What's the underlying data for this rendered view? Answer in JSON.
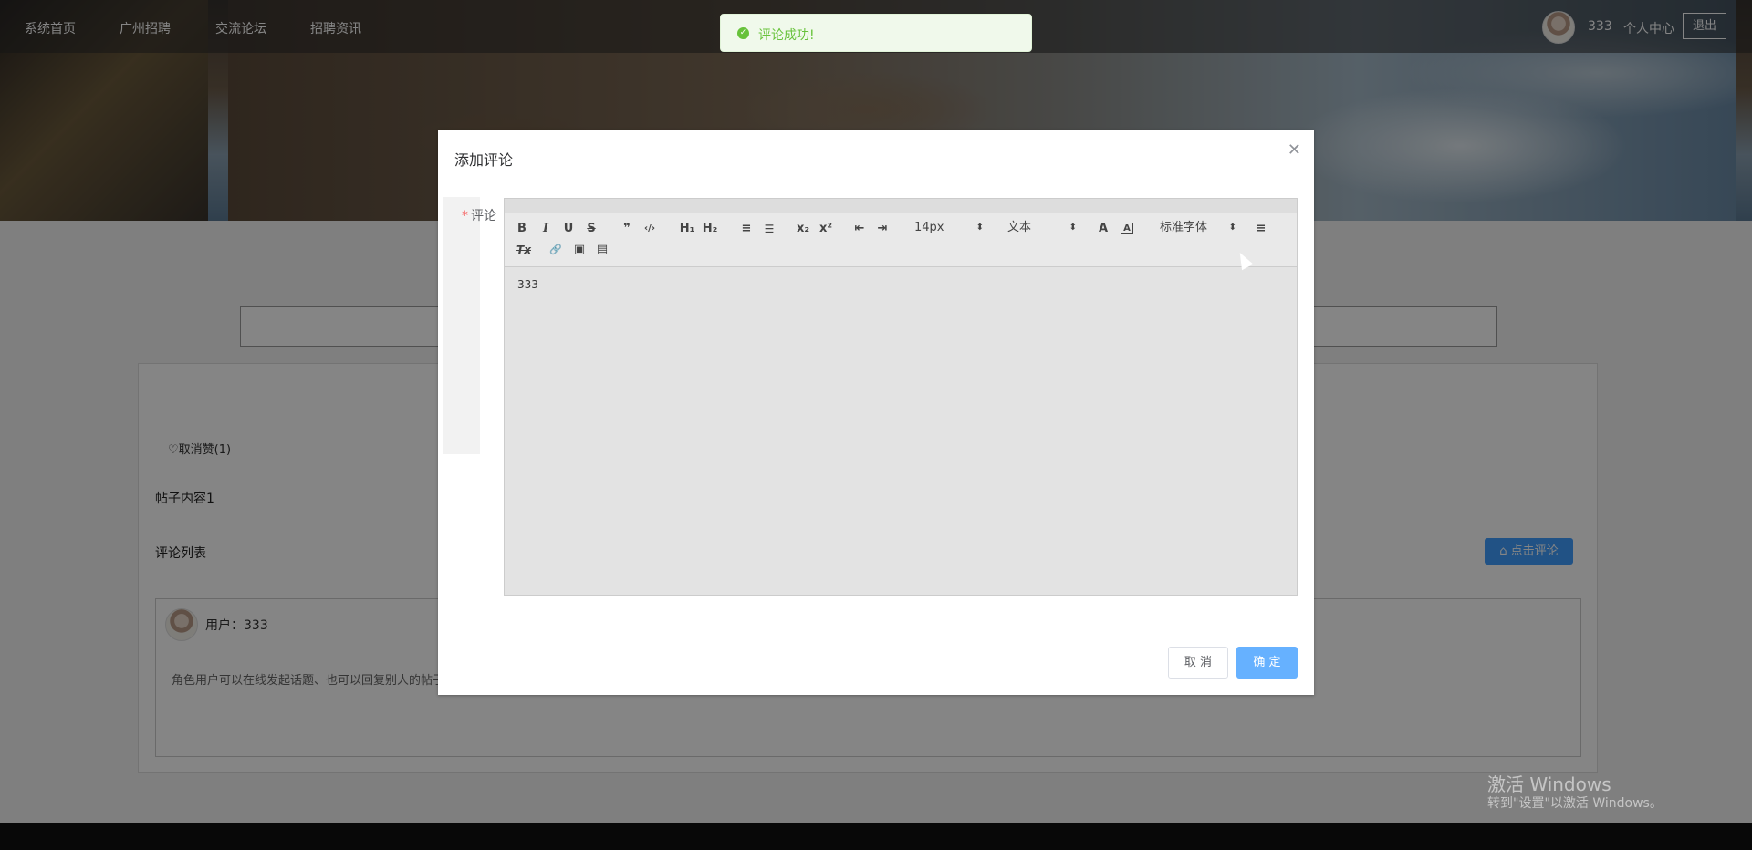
{
  "nav": {
    "items": [
      "系统首页",
      "广州招聘",
      "交流论坛",
      "招聘资讯"
    ],
    "username": "333",
    "personal_center": "个人中心",
    "logout": "退出"
  },
  "post": {
    "like_label": "♡取消赞(1)",
    "content": "帖子内容1",
    "comment_list_title": "评论列表",
    "click_comment_button": "⌂ 点击评论"
  },
  "comment": {
    "user_label": "用户：333",
    "text": "角色用户可以在线发起话题、也可以回复别人的帖子"
  },
  "toast": {
    "message": "评论成功!",
    "icon": "check-circle-icon",
    "color": "#67c23a"
  },
  "dialog": {
    "title": "添加评论",
    "field_label": "评论",
    "required_mark": "*",
    "editor_content": "333",
    "cancel": "取 消",
    "confirm": "确 定"
  },
  "toolbar": {
    "bold": "B",
    "italic": "I",
    "underline": "U",
    "strike": "S",
    "blockquote": "❞",
    "code": "‹/›",
    "h1": "H₁",
    "h2": "H₂",
    "ordered_list": "≡",
    "bullet_list": "☰",
    "subscript": "x₂",
    "superscript": "x²",
    "outdent": "⇤",
    "indent": "⇥",
    "size_select": "14px",
    "header_select": "文本",
    "color": "A",
    "background": "A",
    "font_select": "标准字体",
    "align": "≡",
    "clean": "Tx",
    "link": "🔗",
    "image": "▣",
    "video": "▤"
  },
  "watermark": {
    "title": "激活 Windows",
    "subtitle": "转到\"设置\"以激活 Windows。"
  },
  "colors": {
    "primary": "#409eff",
    "primary_light": "#66b1ff",
    "success": "#67c23a",
    "danger": "#f56c6c"
  }
}
